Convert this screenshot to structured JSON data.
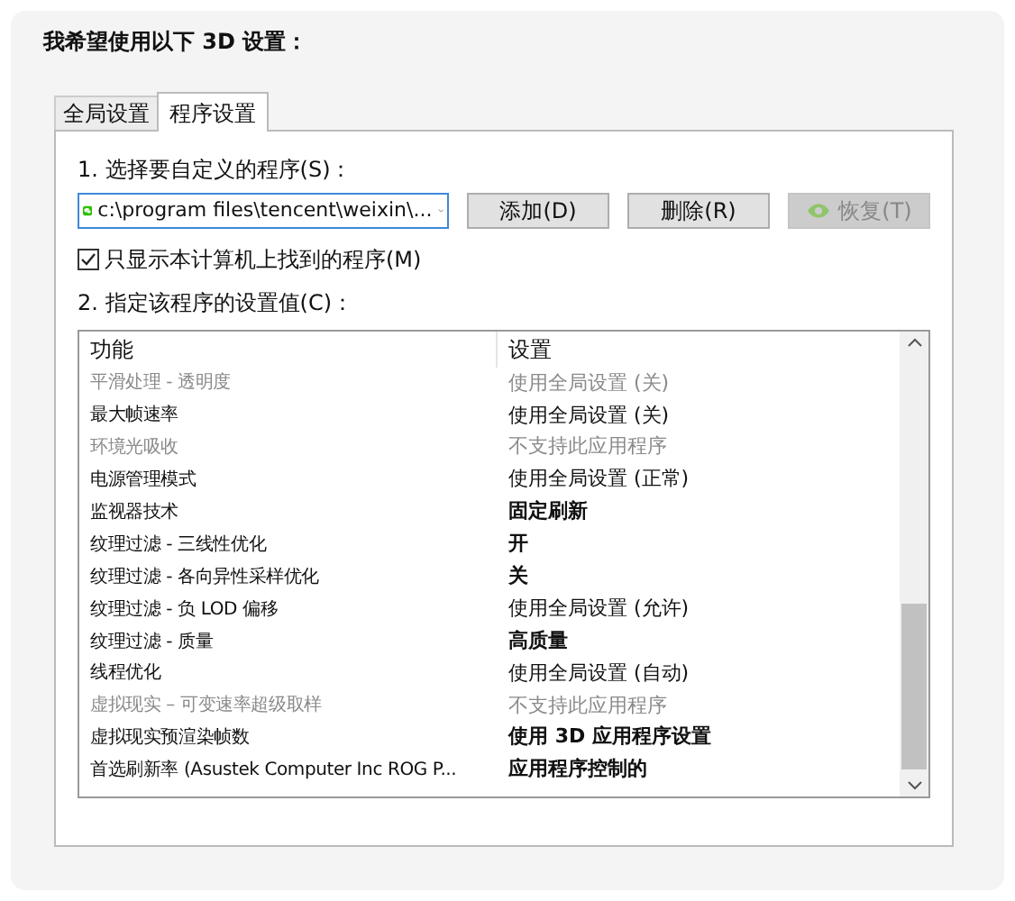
{
  "heading": "我希望使用以下 3D 设置：",
  "tabs": [
    {
      "label": "全局设置",
      "selected": false
    },
    {
      "label": "程序设置",
      "selected": true
    }
  ],
  "program_label": "1. 选择要自定义的程序(S)：",
  "program_select": {
    "value": "c:\\program files\\tencent\\weixin\\..."
  },
  "buttons": [
    {
      "label": "添加(D)",
      "disabled": false
    },
    {
      "label": "删除(R)",
      "disabled": false
    },
    {
      "label": "恢复(T)",
      "disabled": true
    }
  ],
  "only_local_checkbox": {
    "label": "只显示本计算机上找到的程序(M)",
    "checked": true
  },
  "settings_label": "2. 指定该程序的设置值(C)：",
  "table": {
    "columns": [
      "功能",
      "设置"
    ],
    "rows": [
      {
        "feature": "平滑处理 - 透明度",
        "setting": "使用全局设置 (关)",
        "disabled": true,
        "bold": false
      },
      {
        "feature": "最大帧速率",
        "setting": "使用全局设置 (关)",
        "disabled": false,
        "bold": false
      },
      {
        "feature": "环境光吸收",
        "setting": "不支持此应用程序",
        "disabled": true,
        "bold": false
      },
      {
        "feature": "电源管理模式",
        "setting": "使用全局设置 (正常)",
        "disabled": false,
        "bold": false
      },
      {
        "feature": "监视器技术",
        "setting": "固定刷新",
        "disabled": false,
        "bold": true
      },
      {
        "feature": "纹理过滤 - 三线性优化",
        "setting": "开",
        "disabled": false,
        "bold": true
      },
      {
        "feature": "纹理过滤 - 各向异性采样优化",
        "setting": "关",
        "disabled": false,
        "bold": true
      },
      {
        "feature": "纹理过滤 - 负 LOD 偏移",
        "setting": "使用全局设置 (允许)",
        "disabled": false,
        "bold": false
      },
      {
        "feature": "纹理过滤 - 质量",
        "setting": "高质量",
        "disabled": false,
        "bold": true
      },
      {
        "feature": "线程优化",
        "setting": "使用全局设置 (自动)",
        "disabled": false,
        "bold": false
      },
      {
        "feature": "虚拟现实 – 可变速率超级取样",
        "setting": "不支持此应用程序",
        "disabled": true,
        "bold": false
      },
      {
        "feature": "虚拟现实预渲染帧数",
        "setting": "使用 3D 应用程序设置",
        "disabled": false,
        "bold": true
      },
      {
        "feature": "首选刷新率 (Asustek Computer Inc ROG P...",
        "setting": "应用程序控制的",
        "disabled": false,
        "bold": true
      }
    ]
  }
}
